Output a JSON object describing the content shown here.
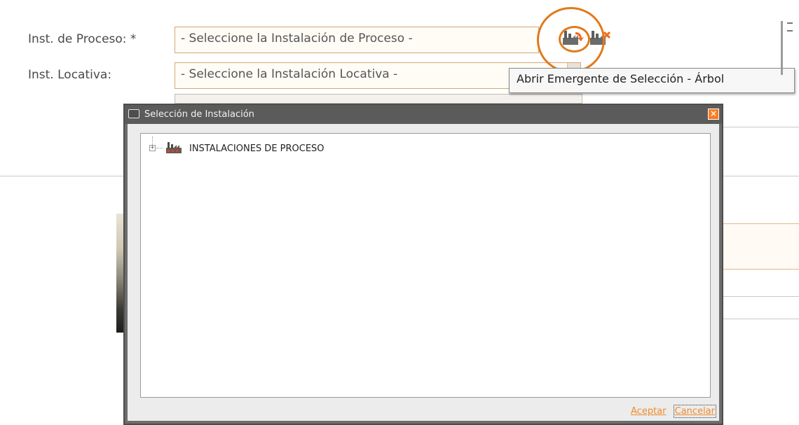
{
  "form": {
    "process_label": "Inst. de Proceso: *",
    "process_select_value": "- Seleccione la Instalación de Proceso -",
    "location_label": "Inst. Locativa:",
    "location_select_value": "- Seleccione la Instalación Locativa -"
  },
  "icons": {
    "open_tree_icon": "factory-tree-icon",
    "clear_icon": "factory-clear-icon"
  },
  "tooltip": {
    "text": "Abrir Emergente de Selección - Árbol"
  },
  "annotations": {
    "color": "#e07a1b"
  },
  "modal": {
    "title": "Selección de Instalación",
    "close_glyph": "×",
    "tree": {
      "root_label": "INSTALACIONES DE PROCESO",
      "expander_glyph": "+"
    },
    "accept_label": "Aceptar",
    "cancel_label": "Cancelar"
  },
  "colors": {
    "accent": "#f08a2a",
    "field_border": "#d4a77a",
    "modal_frame": "#5b5b5b"
  }
}
